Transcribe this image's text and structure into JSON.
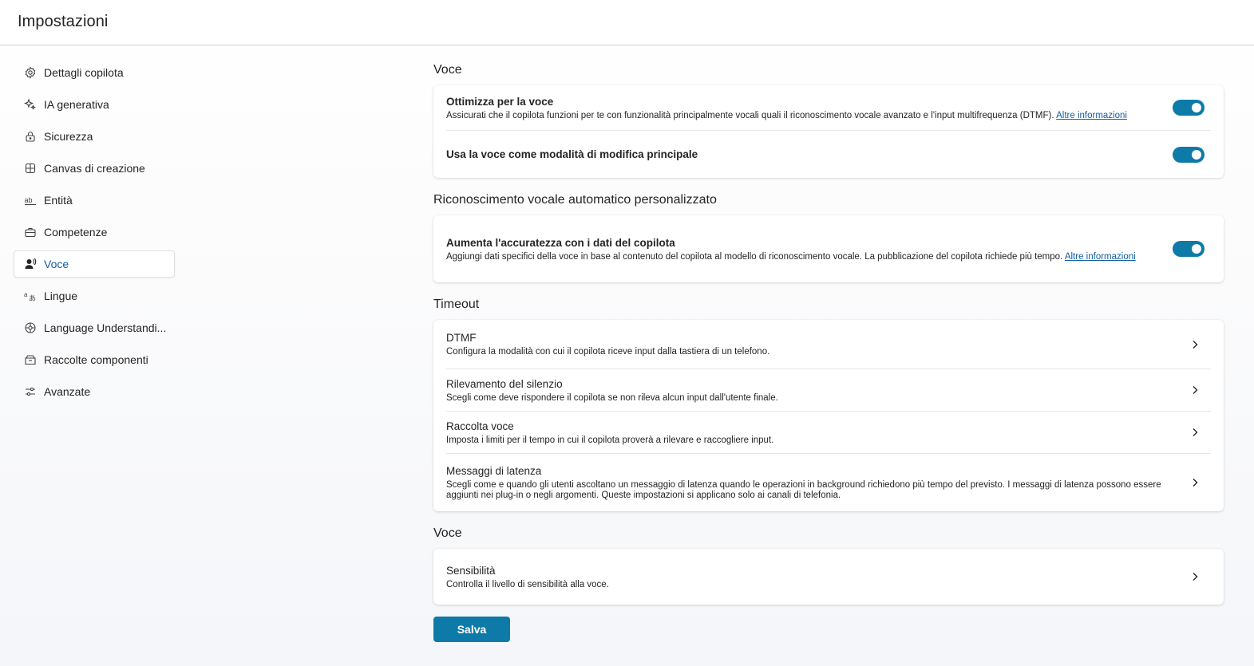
{
  "header": {
    "title": "Impostazioni"
  },
  "sidebar": {
    "items": [
      {
        "label": "Dettagli copilota",
        "icon": "gear-icon"
      },
      {
        "label": "IA generativa",
        "icon": "sparkle-icon"
      },
      {
        "label": "Sicurezza",
        "icon": "lock-icon"
      },
      {
        "label": "Canvas di creazione",
        "icon": "grid-icon"
      },
      {
        "label": "Entità",
        "icon": "abc-icon"
      },
      {
        "label": "Competenze",
        "icon": "briefcase-icon"
      },
      {
        "label": "Voce",
        "icon": "person-voice-icon",
        "active": true
      },
      {
        "label": "Lingue",
        "icon": "translate-icon"
      },
      {
        "label": "Language Understandi...",
        "icon": "brain-circuit-icon"
      },
      {
        "label": "Raccolte componenti",
        "icon": "box-icon"
      },
      {
        "label": "Avanzate",
        "icon": "options-icon"
      }
    ]
  },
  "sections": {
    "voice": {
      "title": "Voce",
      "optimize": {
        "title": "Ottimizza per la voce",
        "description": "Assicurati che il copilota funzioni per te con funzionalità principalmente vocali quali il riconoscimento vocale avanzato e l'input multifrequenza (DTMF).",
        "link": "Altre informazioni",
        "enabled": true
      },
      "primary_mode": {
        "title": "Usa la voce come modalità di modifica principale",
        "enabled": true
      }
    },
    "asr": {
      "title": "Riconoscimento vocale automatico personalizzato",
      "accuracy": {
        "title": "Aumenta l'accuratezza con i dati del copilota",
        "description": "Aggiungi dati specifici della voce in base al contenuto del copilota al modello di riconoscimento vocale. La pubblicazione del copilota richiede più tempo.",
        "link": "Altre informazioni",
        "enabled": true
      }
    },
    "timeout": {
      "title": "Timeout",
      "items": [
        {
          "title": "DTMF",
          "description": "Configura la modalità con cui il copilota riceve input dalla tastiera di un telefono."
        },
        {
          "title": "Rilevamento del silenzio",
          "description": "Scegli come deve rispondere il copilota se non rileva alcun input dall'utente finale."
        },
        {
          "title": "Raccolta voce",
          "description": "Imposta i limiti per il tempo in cui il copilota proverà a rilevare e raccogliere input."
        },
        {
          "title": "Messaggi di latenza",
          "description": "Scegli come e quando gli utenti ascoltano un messaggio di latenza quando le operazioni in background richiedono più tempo del previsto. I messaggi di latenza possono essere aggiunti nei plug-in o negli argomenti. Queste impostazioni si applicano solo ai canali di telefonia."
        }
      ]
    },
    "voice2": {
      "title": "Voce",
      "sensitivity": {
        "title": "Sensibilità",
        "description": "Controlla il livello di sensibilità alla voce."
      }
    }
  },
  "actions": {
    "save_label": "Salva"
  },
  "colors": {
    "accent": "#0e7aa8",
    "link": "#115ea3",
    "active_nav_text": "#115ea3"
  }
}
